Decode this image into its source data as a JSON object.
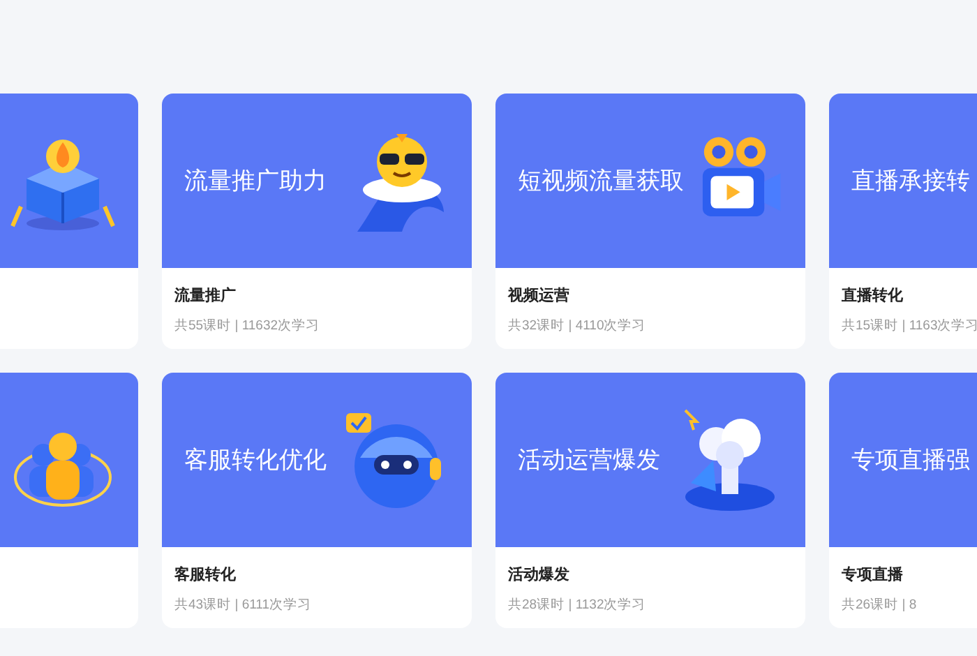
{
  "rows": [
    {
      "cards": [
        {
          "kind": "gift-box"
        },
        {
          "kind": "mascot",
          "banner_title": "流量推广助力",
          "title": "流量推广",
          "meta": "共55课时 | 11632次学习"
        },
        {
          "kind": "camera",
          "banner_title": "短视频流量获取",
          "title": "视频运营",
          "meta": "共32课时 | 4110次学习"
        },
        {
          "kind": "none",
          "banner_title": "直播承接转",
          "title": "直播转化",
          "meta": "共15课时 | 1163次学习"
        }
      ]
    },
    {
      "cards": [
        {
          "kind": "people"
        },
        {
          "kind": "robot",
          "banner_title": "客服转化优化",
          "title": "客服转化",
          "meta": "共43课时 | 6111次学习"
        },
        {
          "kind": "cloud",
          "banner_title": "活动运营爆发",
          "title": "活动爆发",
          "meta": "共28课时 | 1132次学习"
        },
        {
          "kind": "none",
          "banner_title": "专项直播强",
          "title": "专项直播",
          "meta": "共26课时 | 8"
        }
      ]
    }
  ]
}
